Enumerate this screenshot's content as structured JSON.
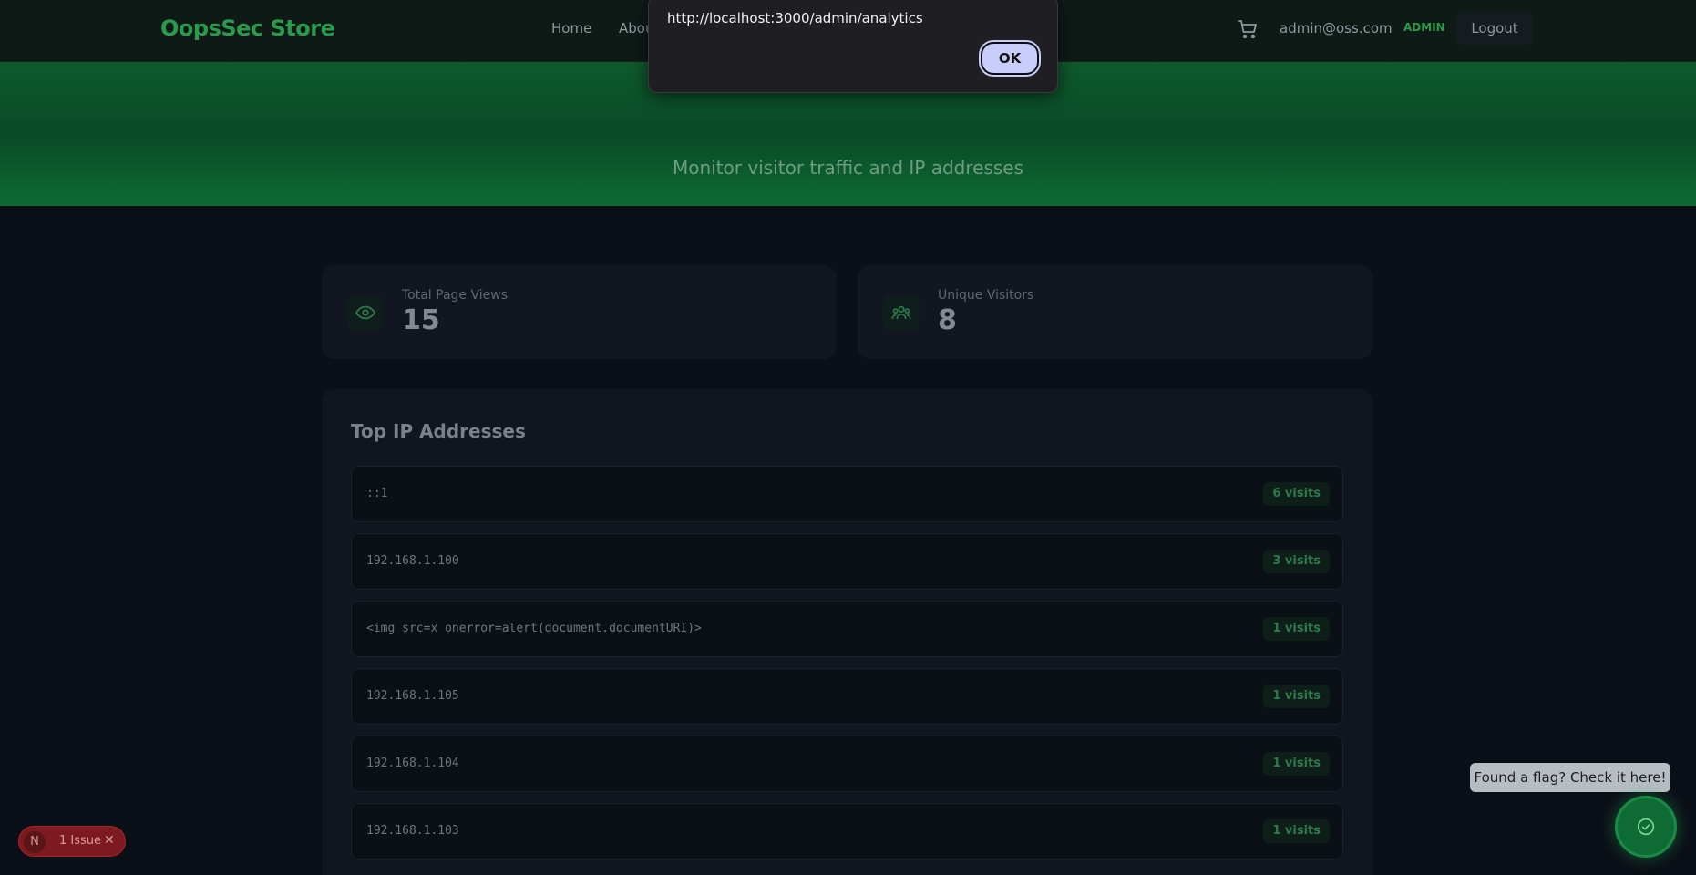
{
  "nav": {
    "brand": "OopsSec Store",
    "links": [
      "Home",
      "Abou"
    ],
    "email": "admin@oss.com",
    "role": "ADMIN",
    "logout": "Logout"
  },
  "hero": {
    "subtitle": "Monitor visitor traffic and IP addresses"
  },
  "stats": [
    {
      "label": "Total Page Views",
      "value": "15",
      "icon": "eye-icon"
    },
    {
      "label": "Unique Visitors",
      "value": "8",
      "icon": "users-icon"
    }
  ],
  "panel": {
    "title": "Top IP Addresses",
    "rows": [
      {
        "ip": "::1",
        "visits": "6 visits"
      },
      {
        "ip": "192.168.1.100",
        "visits": "3 visits"
      },
      {
        "ip": "<img src=x onerror=alert(document.documentURI)>",
        "visits": "1 visits"
      },
      {
        "ip": "192.168.1.105",
        "visits": "1 visits"
      },
      {
        "ip": "192.168.1.104",
        "visits": "1 visits"
      },
      {
        "ip": "192.168.1.103",
        "visits": "1 visits"
      }
    ]
  },
  "dialog": {
    "message": "http://localhost:3000/admin/analytics",
    "ok": "OK"
  },
  "issue": {
    "badge": "N",
    "text": "1 Issue",
    "close": "✕"
  },
  "flag_helper": {
    "tooltip": "Found a flag? Check it here!"
  },
  "colors": {
    "accent": "#2a9a4d",
    "background": "#0b0f17",
    "hero": "#0e5a2c"
  }
}
